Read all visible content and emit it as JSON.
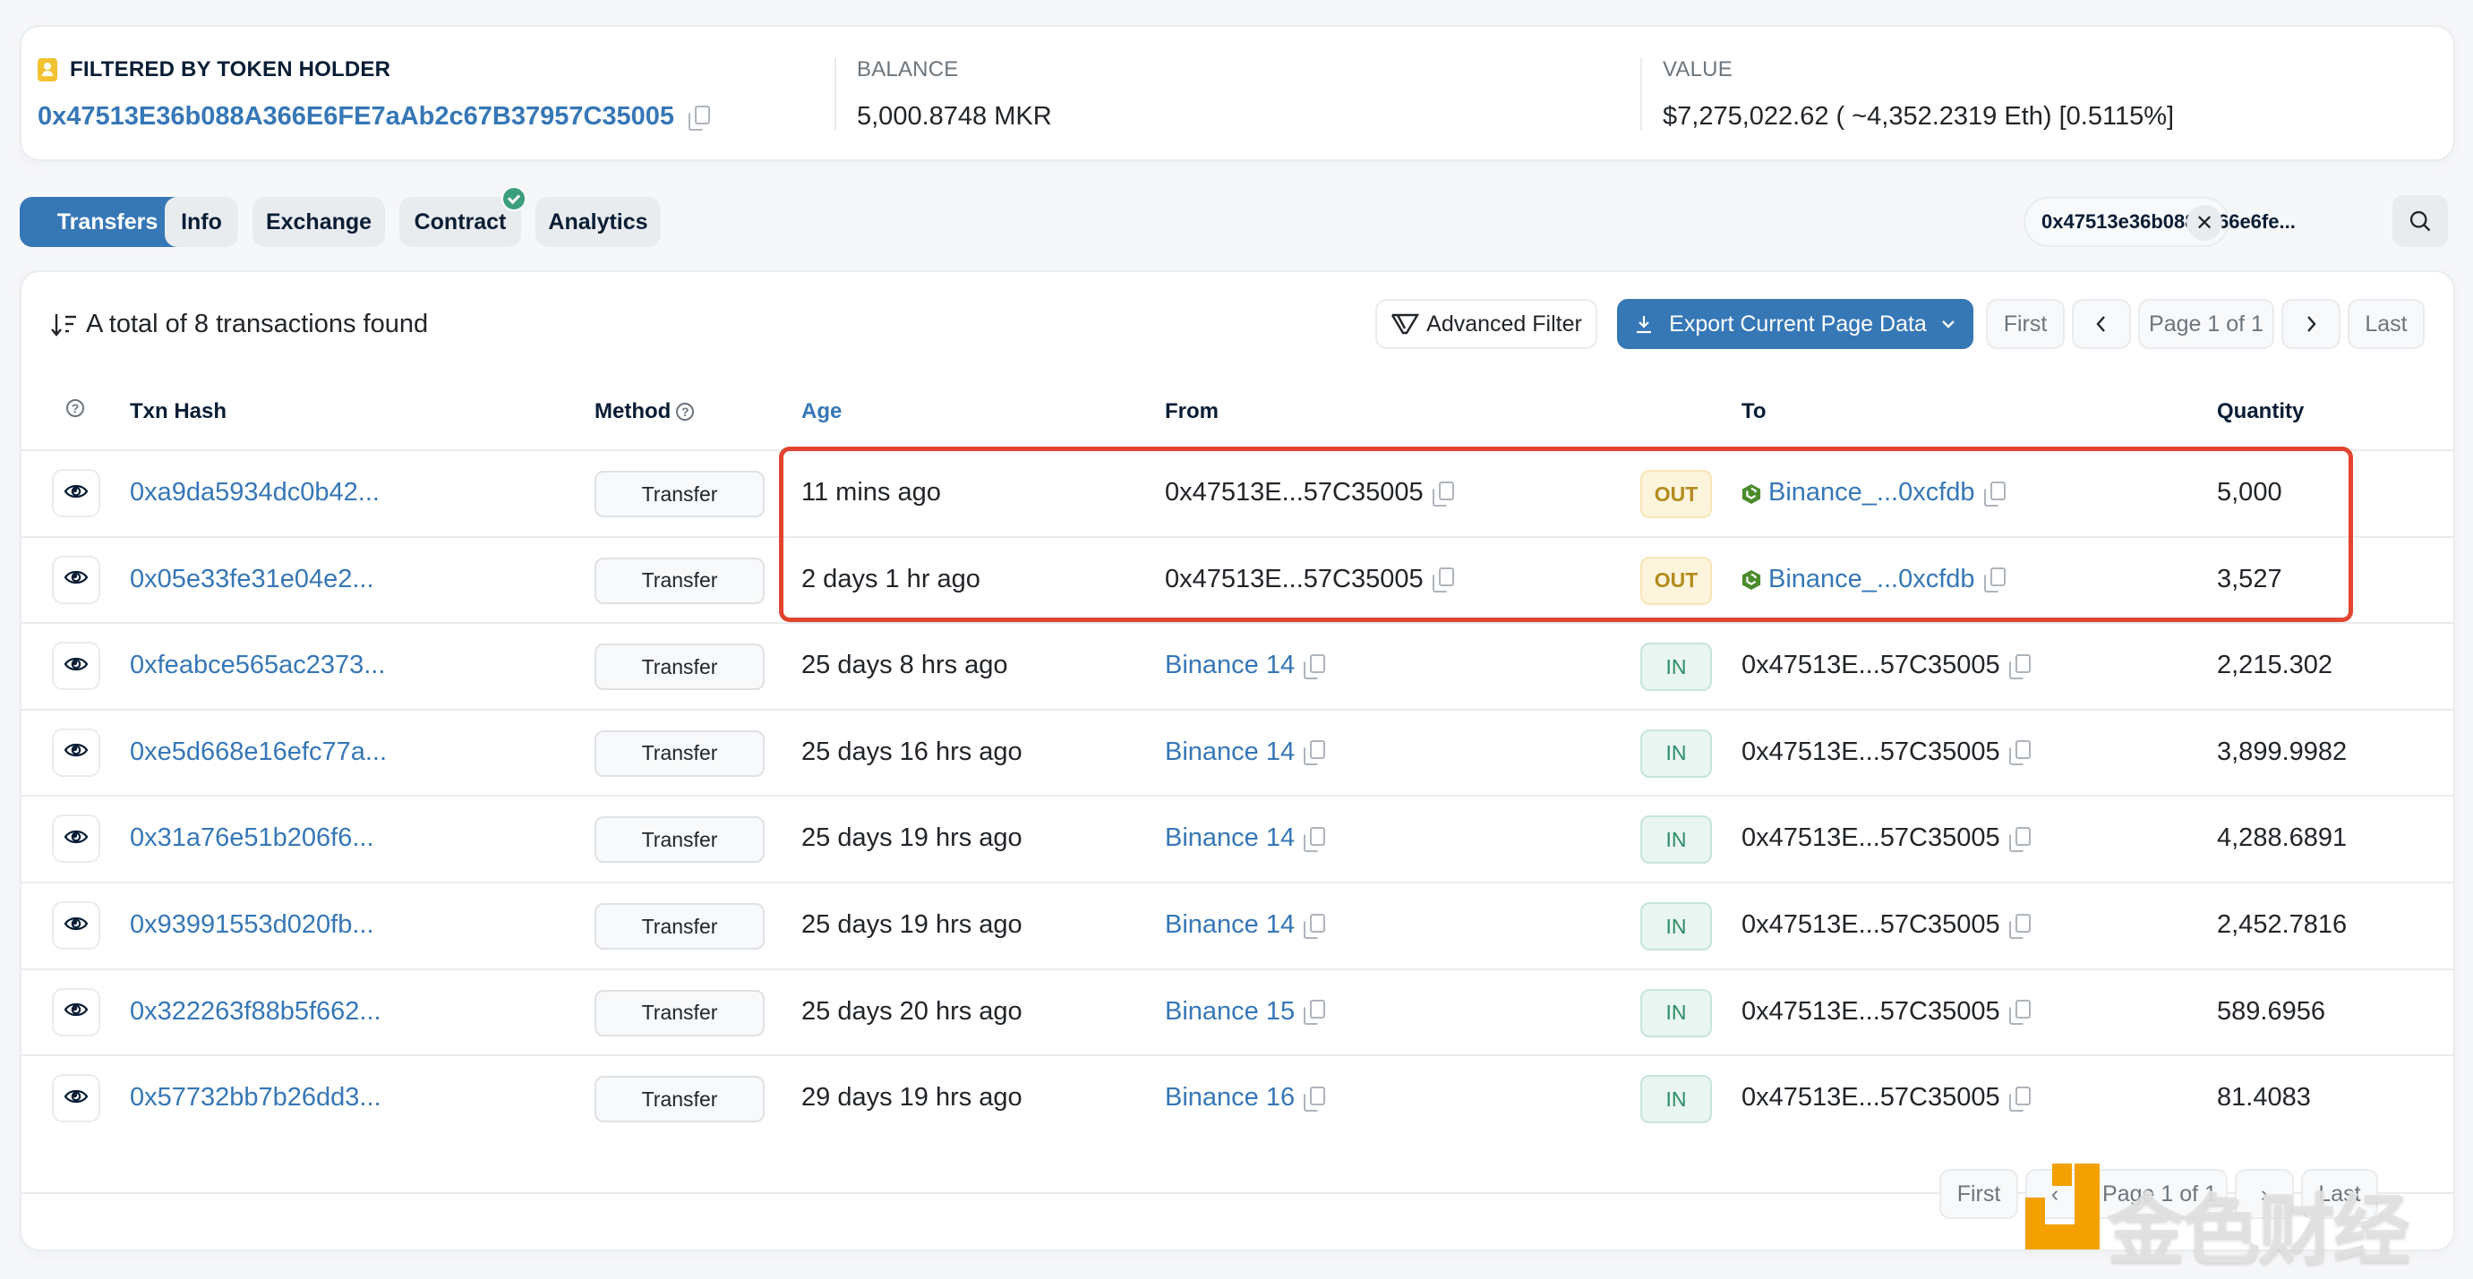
{
  "summary": {
    "holder_label": "FILTERED BY TOKEN HOLDER",
    "holder_address": "0x47513E36b088A366E6FE7aAb2c67B37957C35005",
    "balance_label": "BALANCE",
    "balance_value": "5,000.8748 MKR",
    "value_label": "VALUE",
    "value_value": "$7,275,022.62 ( ~4,352.2319 Eth) [0.5115%]"
  },
  "tabs": [
    {
      "label": "Transfers",
      "active": true
    },
    {
      "label": "Info"
    },
    {
      "label": "Exchange"
    },
    {
      "label": "Contract",
      "verified": true
    },
    {
      "label": "Analytics"
    }
  ],
  "search": {
    "filter_value": "0x47513e36b088a366e6fe...",
    "clear_icon": "close-icon",
    "search_icon": "search-icon"
  },
  "toolbar": {
    "total_text": "A total of 8 transactions found",
    "advanced_filter": "Advanced Filter",
    "export": "Export Current Page Data",
    "first": "First",
    "page": "Page 1 of 1",
    "last": "Last"
  },
  "table": {
    "columns": [
      "",
      "Txn Hash",
      "Method",
      "Age",
      "From",
      "",
      "To",
      "Quantity"
    ],
    "rows": [
      {
        "hash": "0xa9da5934dc0b42...",
        "method": "Transfer",
        "age": "11 mins ago",
        "from": "0x47513E...57C35005",
        "from_link": false,
        "dir": "OUT",
        "to": "Binance_...0xcfdb",
        "to_link": true,
        "to_contract": true,
        "qty": "5,000"
      },
      {
        "hash": "0x05e33fe31e04e2...",
        "method": "Transfer",
        "age": "2 days 1 hr ago",
        "from": "0x47513E...57C35005",
        "from_link": false,
        "dir": "OUT",
        "to": "Binance_...0xcfdb",
        "to_link": true,
        "to_contract": true,
        "qty": "3,527"
      },
      {
        "hash": "0xfeabce565ac2373...",
        "method": "Transfer",
        "age": "25 days 8 hrs ago",
        "from": "Binance 14",
        "from_link": true,
        "dir": "IN",
        "to": "0x47513E...57C35005",
        "to_link": false,
        "to_contract": false,
        "qty": "2,215.302"
      },
      {
        "hash": "0xe5d668e16efc77a...",
        "method": "Transfer",
        "age": "25 days 16 hrs ago",
        "from": "Binance 14",
        "from_link": true,
        "dir": "IN",
        "to": "0x47513E...57C35005",
        "to_link": false,
        "to_contract": false,
        "qty": "3,899.9982"
      },
      {
        "hash": "0x31a76e51b206f6...",
        "method": "Transfer",
        "age": "25 days 19 hrs ago",
        "from": "Binance 14",
        "from_link": true,
        "dir": "IN",
        "to": "0x47513E...57C35005",
        "to_link": false,
        "to_contract": false,
        "qty": "4,288.6891"
      },
      {
        "hash": "0x93991553d020fb...",
        "method": "Transfer",
        "age": "25 days 19 hrs ago",
        "from": "Binance 14",
        "from_link": true,
        "dir": "IN",
        "to": "0x47513E...57C35005",
        "to_link": false,
        "to_contract": false,
        "qty": "2,452.7816"
      },
      {
        "hash": "0x322263f88b5f662...",
        "method": "Transfer",
        "age": "25 days 20 hrs ago",
        "from": "Binance 15",
        "from_link": true,
        "dir": "IN",
        "to": "0x47513E...57C35005",
        "to_link": false,
        "to_contract": false,
        "qty": "589.6956"
      },
      {
        "hash": "0x57732bb7b26dd3...",
        "method": "Transfer",
        "age": "29 days 19 hrs ago",
        "from": "Binance 16",
        "from_link": true,
        "dir": "IN",
        "to": "0x47513E...57C35005",
        "to_link": false,
        "to_contract": false,
        "qty": "81.4083"
      }
    ]
  },
  "bottom_pagination": {
    "first": "First",
    "page": "Page 1 of 1",
    "last": "Last"
  },
  "watermark": {
    "text": "金色财经"
  },
  "colors": {
    "accent": "#3677b6",
    "highlight": "#e2452f",
    "out": "#b48b1d",
    "in": "#2d8c67",
    "verified": "#3c9f7c"
  }
}
